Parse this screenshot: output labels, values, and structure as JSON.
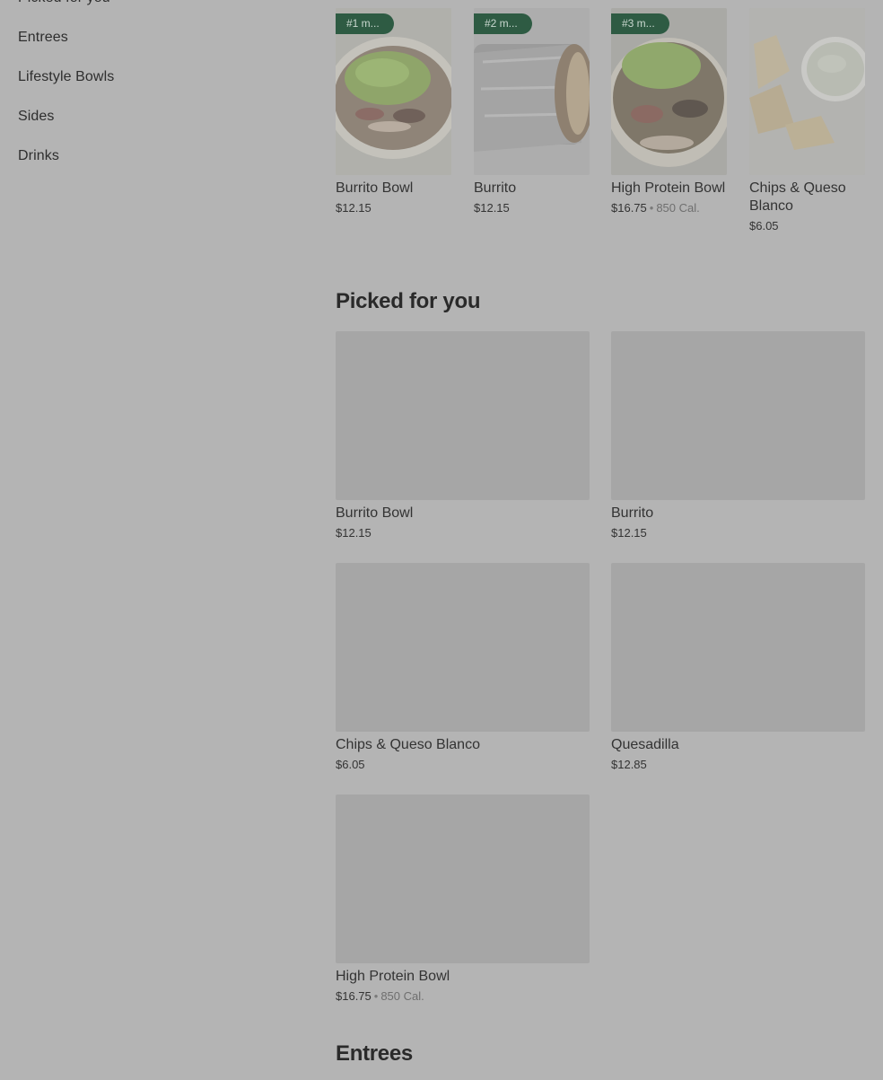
{
  "sidebar": {
    "items": [
      {
        "label": "Picked for you"
      },
      {
        "label": "Entrees"
      },
      {
        "label": "Lifestyle Bowls"
      },
      {
        "label": "Sides"
      },
      {
        "label": "Drinks"
      }
    ]
  },
  "featured": [
    {
      "badge": "#1 m...",
      "name": "Burrito Bowl",
      "price": "$12.15",
      "calories": ""
    },
    {
      "badge": "#2 m...",
      "name": "Burrito",
      "price": "$12.15",
      "calories": ""
    },
    {
      "badge": "#3 m...",
      "name": "High Protein Bowl",
      "price": "$16.75",
      "calories": "850 Cal."
    },
    {
      "badge": "",
      "name": "Chips & Queso Blanco",
      "price": "$6.05",
      "calories": ""
    }
  ],
  "picked_section": {
    "title": "Picked for you",
    "items": [
      {
        "name": "Burrito Bowl",
        "price": "$12.15",
        "calories": ""
      },
      {
        "name": "Burrito",
        "price": "$12.15",
        "calories": ""
      },
      {
        "name": "Chips & Queso Blanco",
        "price": "$6.05",
        "calories": ""
      },
      {
        "name": "Quesadilla",
        "price": "$12.85",
        "calories": ""
      },
      {
        "name": "High Protein Bowl",
        "price": "$16.75",
        "calories": "850 Cal."
      }
    ]
  },
  "entrees_section": {
    "title": "Entrees"
  },
  "separator": "•",
  "colors": {
    "overlay_bg": "#b4b4b4",
    "badge_bg": "#2e5b43",
    "placeholder": "#a6a6a6"
  }
}
